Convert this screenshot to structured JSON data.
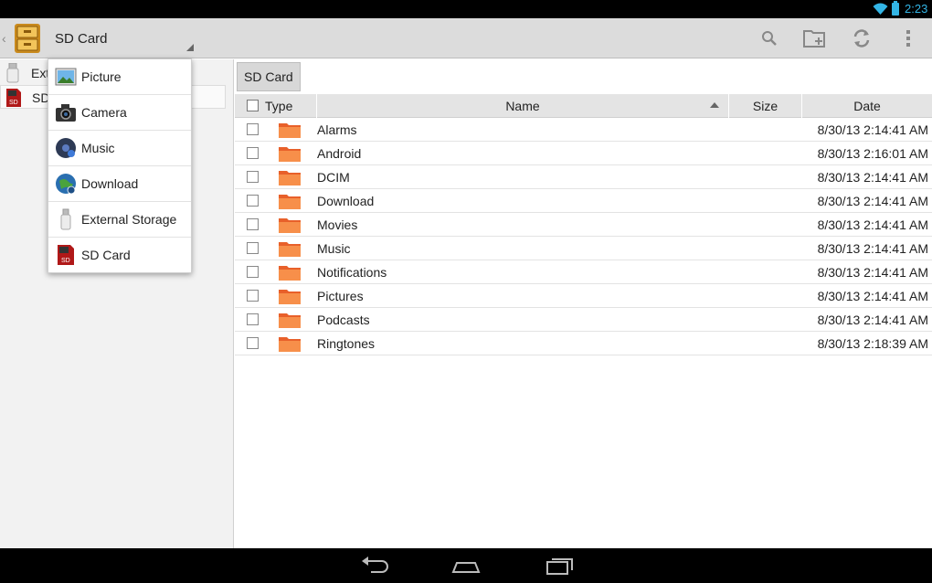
{
  "status_bar": {
    "time": "2:23",
    "accent_color": "#33b5e5"
  },
  "action_bar": {
    "title": "SD Card",
    "icons": [
      "search-icon",
      "new-folder-icon",
      "refresh-icon",
      "overflow-menu-icon"
    ]
  },
  "left_panel": {
    "items": [
      {
        "label": "Ext",
        "icon": "usb-drive-icon"
      },
      {
        "label": "SD",
        "icon": "sd-card-icon"
      }
    ]
  },
  "dropdown": {
    "items": [
      {
        "label": "Picture",
        "icon": "picture-icon"
      },
      {
        "label": "Camera",
        "icon": "camera-icon"
      },
      {
        "label": "Music",
        "icon": "music-icon"
      },
      {
        "label": "Download",
        "icon": "download-icon"
      },
      {
        "label": "External Storage",
        "icon": "usb-drive-icon"
      },
      {
        "label": "SD Card",
        "icon": "sd-card-icon"
      }
    ]
  },
  "breadcrumb": {
    "current": "SD Card"
  },
  "table": {
    "columns": {
      "type": "Type",
      "name": "Name",
      "size": "Size",
      "date": "Date"
    },
    "sort": {
      "column": "Name",
      "direction": "ascending"
    },
    "rows": [
      {
        "name": "Alarms",
        "date": "8/30/13 2:14:41 AM"
      },
      {
        "name": "Android",
        "date": "8/30/13 2:16:01 AM"
      },
      {
        "name": "DCIM",
        "date": "8/30/13 2:14:41 AM"
      },
      {
        "name": "Download",
        "date": "8/30/13 2:14:41 AM"
      },
      {
        "name": "Movies",
        "date": "8/30/13 2:14:41 AM"
      },
      {
        "name": "Music",
        "date": "8/30/13 2:14:41 AM"
      },
      {
        "name": "Notifications",
        "date": "8/30/13 2:14:41 AM"
      },
      {
        "name": "Pictures",
        "date": "8/30/13 2:14:41 AM"
      },
      {
        "name": "Podcasts",
        "date": "8/30/13 2:14:41 AM"
      },
      {
        "name": "Ringtones",
        "date": "8/30/13 2:18:39 AM"
      }
    ]
  },
  "nav_bar": {
    "buttons": [
      "back-icon",
      "home-icon",
      "recent-apps-icon"
    ]
  }
}
